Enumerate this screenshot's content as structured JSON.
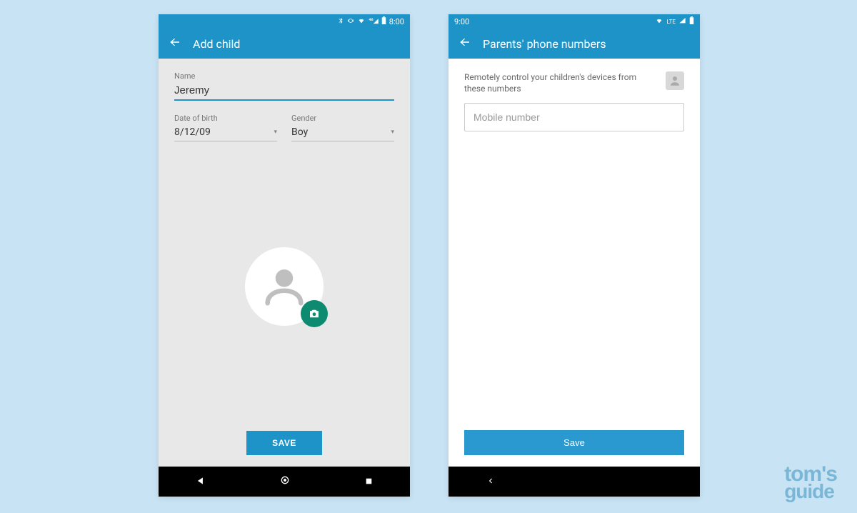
{
  "colors": {
    "accent": "#1e93c8",
    "fab": "#0e8a70"
  },
  "watermark": {
    "line1": "tom's",
    "line2": "guide"
  },
  "left": {
    "status": {
      "time": "8:00"
    },
    "appbar": {
      "title": "Add child"
    },
    "name": {
      "label": "Name",
      "value": "Jeremy"
    },
    "dob": {
      "label": "Date of birth",
      "value": "8/12/09"
    },
    "gender": {
      "label": "Gender",
      "value": "Boy"
    },
    "save_label": "SAVE",
    "icons": {
      "back": "back-arrow-icon",
      "avatar": "person-icon",
      "camera": "camera-icon",
      "nav_back": "triangle-back-icon",
      "nav_home": "circle-home-icon",
      "nav_recent": "square-recent-icon",
      "status_icons": [
        "bluetooth-icon",
        "vibrate-icon",
        "wifi-icon",
        "signal-icon",
        "battery-icon"
      ]
    }
  },
  "right": {
    "status": {
      "time": "9:00",
      "network": "LTE"
    },
    "appbar": {
      "title": "Parents' phone numbers"
    },
    "info_text": "Remotely control your children's devices from these numbers",
    "mobile": {
      "placeholder": "Mobile number",
      "value": ""
    },
    "save_label": "Save",
    "icons": {
      "back": "back-arrow-icon",
      "avatar_small": "person-icon",
      "nav_back": "chevron-left-icon",
      "nav_home": "pill-home-icon",
      "status_icons": [
        "wifi-icon",
        "signal-icon",
        "battery-icon"
      ]
    }
  }
}
